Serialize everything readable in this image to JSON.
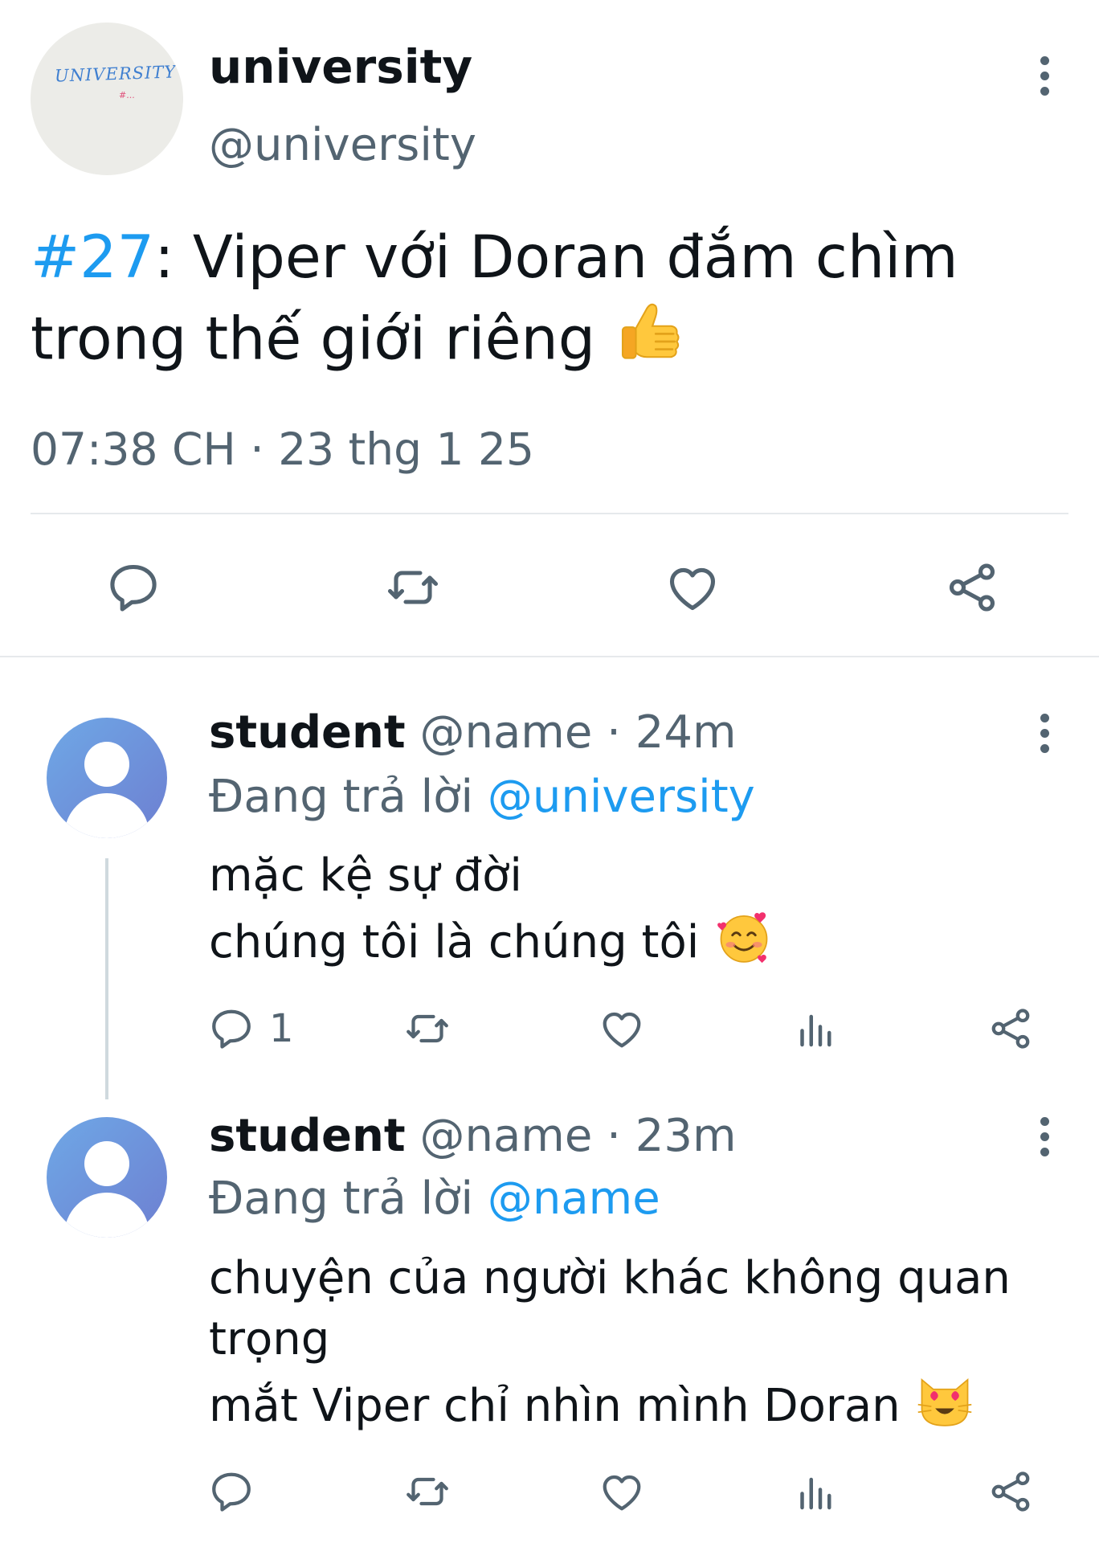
{
  "main_tweet": {
    "display_name": "university",
    "handle": "@university",
    "avatar_text": "UNIVERSITY",
    "avatar_subtext": "#...",
    "hashtag": "#27",
    "text_rest": ": Viper với Doran đắm chìm\ntrong thế giới riêng",
    "emoji": "thumbs-up-icon",
    "timestamp": "07:38 CH · 23 thg 1 25",
    "actions": [
      "reply-icon",
      "retweet-icon",
      "like-icon",
      "share-icon"
    ]
  },
  "replies": [
    {
      "display_name": "student",
      "handle": "@name",
      "separator": "·",
      "age": "24m",
      "replying_prefix": "Đang trả lời ",
      "replying_to": "@university",
      "text": "mặc kệ sự đời\nchúng tôi là chúng tôi",
      "emoji": "smiling-face-with-hearts-icon",
      "reply_count": "1"
    },
    {
      "display_name": "student",
      "handle": "@name",
      "separator": "·",
      "age": "23m",
      "replying_prefix": "Đang trả lời ",
      "replying_to": "@name",
      "text": "chuyện của người khác không quan\ntrọng\nmắt Viper chỉ nhìn mình Doran",
      "emoji": "heart-eyes-cat-icon",
      "reply_count": ""
    }
  ],
  "colors": {
    "text": "#0f1419",
    "secondary": "#536471",
    "link": "#1d9bf0",
    "divider": "#e6e9ec"
  }
}
